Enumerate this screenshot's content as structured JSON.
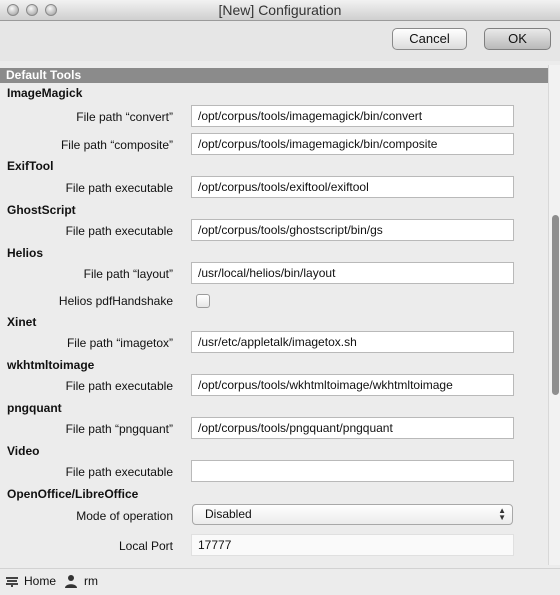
{
  "window": {
    "title": "[New] Configuration"
  },
  "toolbar": {
    "cancel_label": "Cancel",
    "ok_label": "OK"
  },
  "section": {
    "title": "Default Tools"
  },
  "groups": {
    "imagemagick": {
      "title": "ImageMagick",
      "convert_label": "File path “convert”",
      "convert_value": "/opt/corpus/tools/imagemagick/bin/convert",
      "composite_label": "File path “composite”",
      "composite_value": "/opt/corpus/tools/imagemagick/bin/composite"
    },
    "exiftool": {
      "title": "ExifTool",
      "label": "File path executable",
      "value": "/opt/corpus/tools/exiftool/exiftool"
    },
    "ghostscript": {
      "title": "GhostScript",
      "label": "File path executable",
      "value": "/opt/corpus/tools/ghostscript/bin/gs"
    },
    "helios": {
      "title": "Helios",
      "layout_label": "File path “layout”",
      "layout_value": "/usr/local/helios/bin/layout",
      "handshake_label": "Helios pdfHandshake",
      "handshake_checked": false
    },
    "xinet": {
      "title": "Xinet",
      "label": "File path “imagetox”",
      "value": "/usr/etc/appletalk/imagetox.sh"
    },
    "wkhtmltoimage": {
      "title": "wkhtmltoimage",
      "label": "File path executable",
      "value": "/opt/corpus/tools/wkhtmltoimage/wkhtmltoimage"
    },
    "pngquant": {
      "title": "pngquant",
      "label": "File path “pngquant”",
      "value": "/opt/corpus/tools/pngquant/pngquant"
    },
    "video": {
      "title": "Video",
      "label": "File path executable",
      "value": ""
    },
    "office": {
      "title": "OpenOffice/LibreOffice",
      "mode_label": "Mode of operation",
      "mode_value": "Disabled",
      "port_label": "Local Port",
      "port_value": "17777"
    }
  },
  "statusbar": {
    "home_label": "Home",
    "user_label": "rm",
    "home_icon": "home-icon",
    "user_icon": "user-icon"
  }
}
